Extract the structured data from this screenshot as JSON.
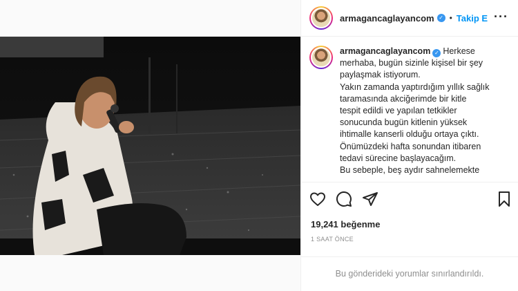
{
  "post": {
    "username": "armagancaglayancom",
    "follow_label": "Takip E",
    "separator": "•",
    "more_icon": "more-horizontal-icon",
    "verified_icon": "verified-badge-icon"
  },
  "caption": {
    "username": "armagancaglayancom",
    "lines": [
      "Herkese",
      "merhaba, bugün sizinle kişisel bir şey",
      "paylaşmak istiyorum.",
      "Yakın zamanda yaptırdığım yıllık sağlık",
      "taramasında akciğerimde bir kitle",
      "tespit edildi ve yapılan tetkikler",
      "sonucunda bugün kitlenin yüksek",
      "ihtimalle kanserli olduğu ortaya çıktı.",
      "Önümüzdeki hafta sonundan itibaren",
      "tedavi sürecine başlayacağım.",
      "Bu sebeple, beş aydır sahnelemekte"
    ]
  },
  "actions": {
    "like_icon": "heart-icon",
    "comment_icon": "comment-icon",
    "share_icon": "share-icon",
    "save_icon": "bookmark-icon"
  },
  "likes_text": "19,241 beğenme",
  "time_text": "1 SAAT ÖNCE",
  "comments_limited_text": "Bu gönderideki yorumlar sınırlandırıldı.",
  "colors": {
    "link_blue": "#0095f6",
    "verified_blue": "#3897f0",
    "text": "#262626",
    "muted": "#8e8e8e"
  }
}
